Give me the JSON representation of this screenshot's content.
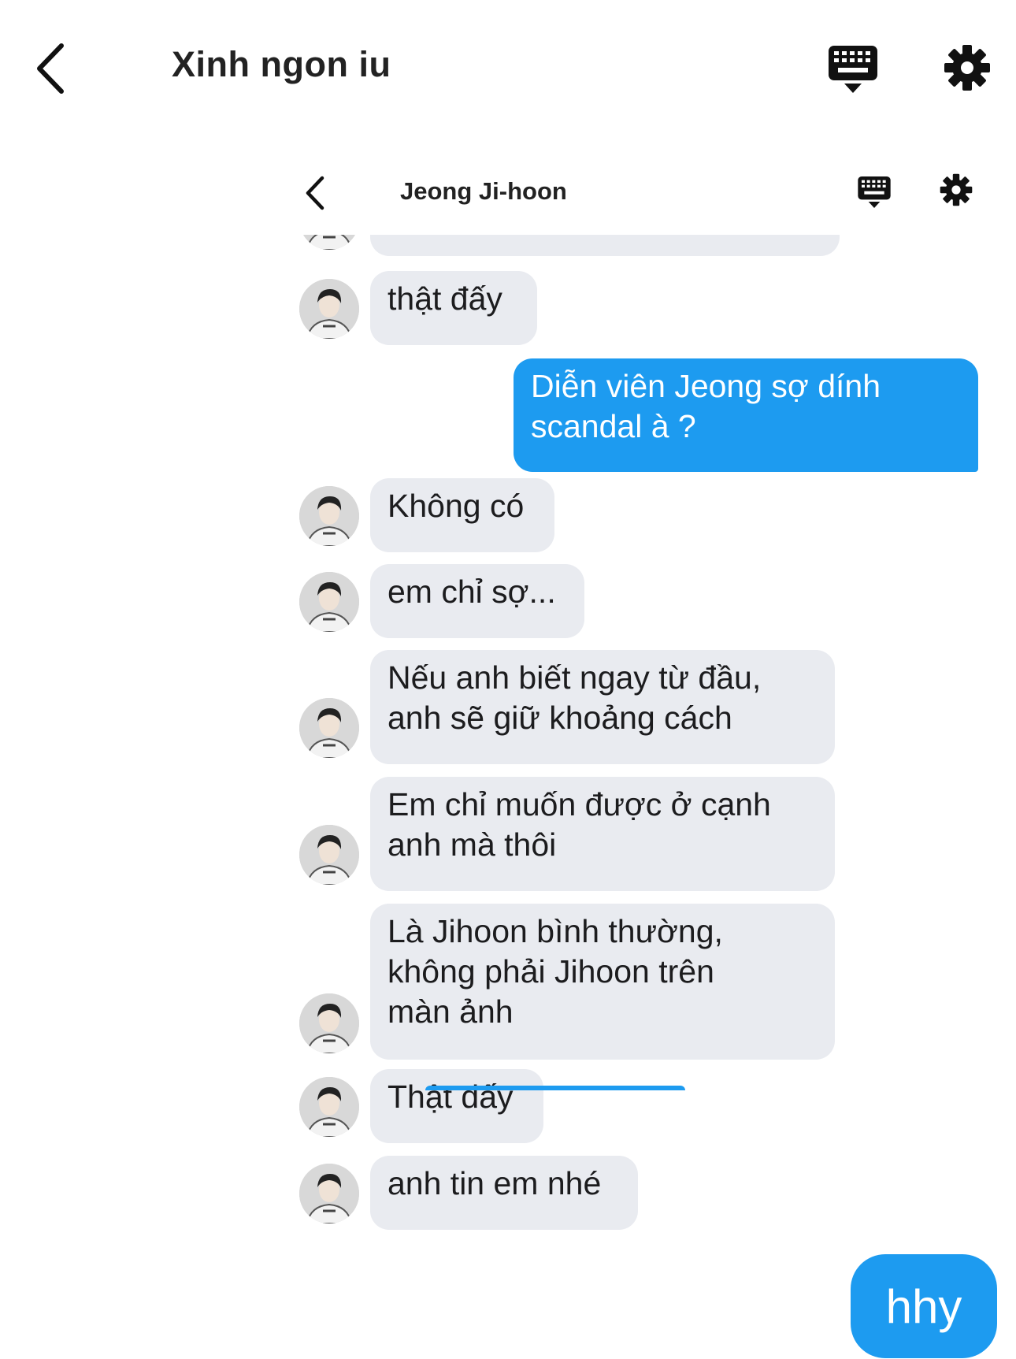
{
  "outer": {
    "title": "Xinh ngon iu",
    "icons": {
      "back": "chevron-left-icon",
      "keyboard": "keyboard-icon",
      "settings": "gear-icon"
    },
    "sent_message": "hhy"
  },
  "inner": {
    "title": "Jeong Ji-hoon",
    "icons": {
      "back": "chevron-left-icon",
      "keyboard": "keyboard-icon",
      "settings": "gear-icon"
    },
    "messages": [
      {
        "from": "them",
        "text": ""
      },
      {
        "from": "them",
        "text": "thật đấy"
      },
      {
        "from": "me",
        "text": "Diễn viên Jeong sợ dính\nscandal à ?"
      },
      {
        "from": "them",
        "text": "Không có"
      },
      {
        "from": "them",
        "text": "em chỉ sợ..."
      },
      {
        "from": "them",
        "text": "Nếu anh biết ngay từ đầu,\nanh sẽ giữ khoảng cách"
      },
      {
        "from": "them",
        "text": "Em chỉ muốn được ở cạnh\nanh mà thôi"
      },
      {
        "from": "them",
        "text": "Là Jihoon bình thường,\nkhông phải Jihoon trên\nmàn ảnh"
      },
      {
        "from": "them",
        "text": "Thật đấy"
      },
      {
        "from": "them",
        "text": "anh tin em nhé"
      }
    ]
  },
  "colors": {
    "sent": "#1d9bf0",
    "received": "#e9ebf0",
    "text": "#1c1c1e"
  }
}
